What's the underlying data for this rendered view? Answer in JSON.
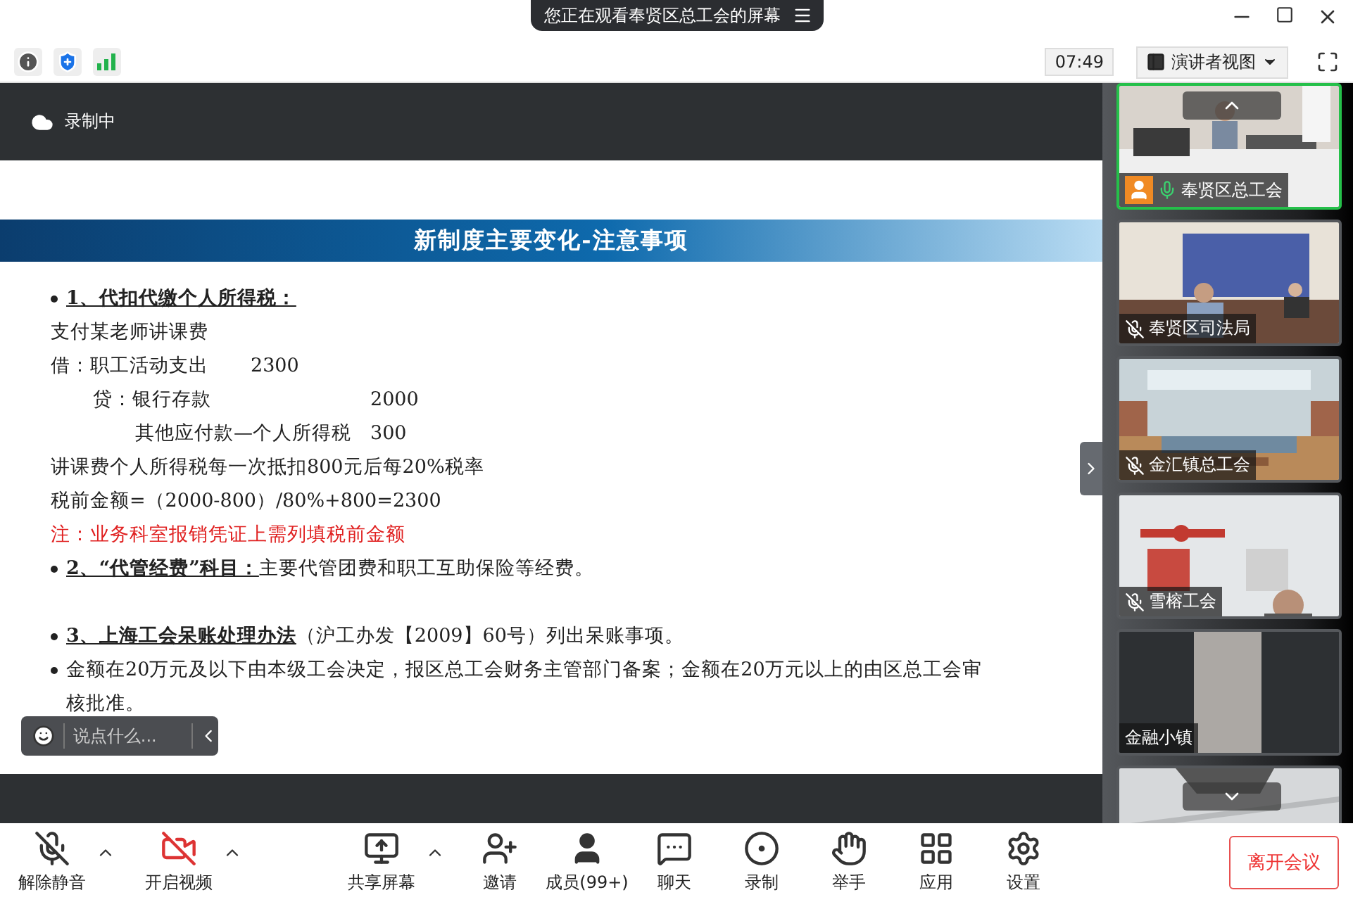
{
  "window": {
    "banner": "您正在观看奉贤区总工会的屏幕",
    "time": "07:49",
    "view_button": "演讲者视图"
  },
  "recording": {
    "label": "录制中"
  },
  "slide": {
    "title": "新制度主要变化-注意事项",
    "lines": [
      {
        "kind": "bullet",
        "head": "1、代扣代缴个人所得税："
      },
      {
        "kind": "plain",
        "text": "支付某老师讲课费"
      },
      {
        "kind": "debit",
        "label": "借：职工活动支出",
        "amount": "2300"
      },
      {
        "kind": "credit",
        "label": "贷：银行存款",
        "amount": "2000"
      },
      {
        "kind": "credit_sub",
        "label": "其他应付款—个人所得税",
        "amount": "300"
      },
      {
        "kind": "plain",
        "text": "讲课费个人所得税每一次抵扣800元后每20%税率"
      },
      {
        "kind": "plain",
        "text": "税前金额=（2000-800）/80%+800=2300"
      },
      {
        "kind": "note",
        "text": "注：业务科室报销凭证上需列填税前金额"
      },
      {
        "kind": "bullet",
        "head": "2、“代管经费”科目：",
        "text": "主要代管团费和职工互助保险等经费。"
      },
      {
        "kind": "gap"
      },
      {
        "kind": "bullet",
        "head": "3、上海工会呆账处理办法",
        "text": "（沪工办发【2009】60号）列出呆账事项。"
      },
      {
        "kind": "bullet",
        "text": "金额在20万元及以下由本级工会决定，报区总工会财务主管部门备案；金额在20万元以上的由区总工会审核批准。"
      }
    ]
  },
  "chat": {
    "placeholder": "说点什么..."
  },
  "participants": [
    {
      "kind": "mic_on",
      "name": "奉贤区总工会",
      "speaking": true,
      "avatar": true
    },
    {
      "kind": "mic_muted",
      "name": "奉贤区司法局",
      "speaking": false,
      "avatar": false
    },
    {
      "kind": "mic_muted",
      "name": "金汇镇总工会",
      "speaking": false,
      "avatar": false
    },
    {
      "kind": "mic_muted",
      "name": "雪榕工会",
      "speaking": false,
      "avatar": false
    },
    {
      "kind": "no_mic",
      "name": "金融小镇",
      "speaking": false,
      "avatar": false
    },
    {
      "kind": "picture"
    }
  ],
  "toolbar": [
    {
      "label": "解除静音",
      "menu": true
    },
    {
      "label": "开启视频",
      "menu": true
    },
    {
      "label": "共享屏幕",
      "menu": true
    },
    {
      "label": "邀请",
      "menu": false
    },
    {
      "label": "成员(99+)",
      "menu": false
    },
    {
      "label": "聊天",
      "menu": false
    },
    {
      "label": "录制",
      "menu": false
    },
    {
      "label": "举手",
      "menu": false
    },
    {
      "label": "应用",
      "menu": false
    },
    {
      "label": "设置",
      "menu": false
    }
  ],
  "leave": "离开会议"
}
